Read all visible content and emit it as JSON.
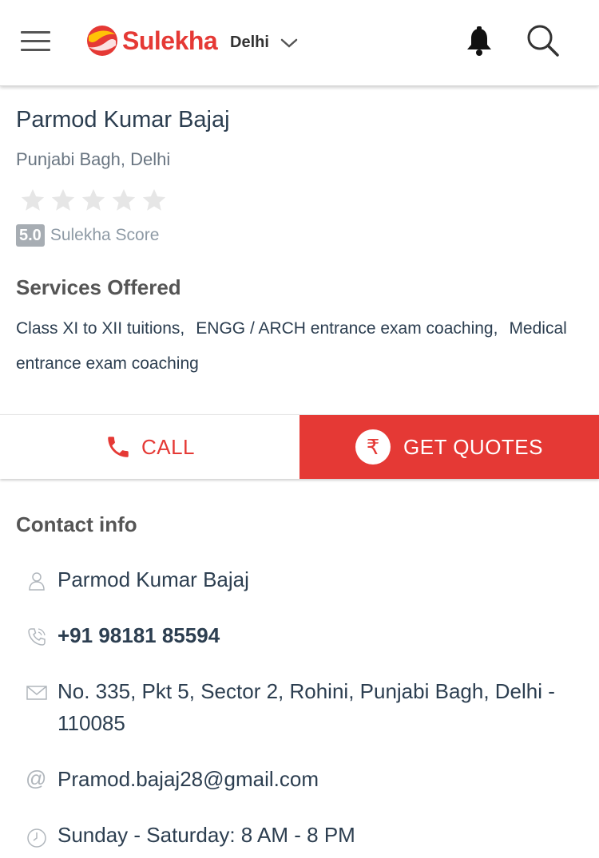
{
  "header": {
    "logo_text": "Sulekha",
    "city": "Delhi",
    "icons": {
      "menu": "hamburger-menu-icon",
      "bell": "bell-icon",
      "search": "search-icon",
      "city_toggle": "chevron-down-icon"
    }
  },
  "listing": {
    "name": "Parmod Kumar Bajaj",
    "locality": "Punjabi Bagh, Delhi",
    "rating_stars_filled": 0,
    "rating_stars_total": 5,
    "score_value": "5.0",
    "score_label": "Sulekha Score"
  },
  "services": {
    "heading": "Services Offered",
    "items": [
      "Class XI to XII tuitions,",
      "ENGG / ARCH entrance exam coaching,",
      "Medical entrance exam coaching"
    ]
  },
  "actions": {
    "call_label": "CALL",
    "quotes_label": "GET QUOTES",
    "rupee_symbol": "₹"
  },
  "contact": {
    "heading": "Contact info",
    "name": "Parmod Kumar Bajaj",
    "phone": "+91 98181 85594",
    "address": "No. 335, Pkt 5, Sector 2, Rohini, Punjabi Bagh, Delhi - 110085",
    "email": "Pramod.bajaj28@gmail.com",
    "hours": "Sunday - Saturday: 8 AM - 8 PM"
  },
  "colors": {
    "brand": "#e53935",
    "text_primary": "#2c3e50",
    "text_muted": "#8e9aa5",
    "star_empty": "#e6e6e6"
  }
}
